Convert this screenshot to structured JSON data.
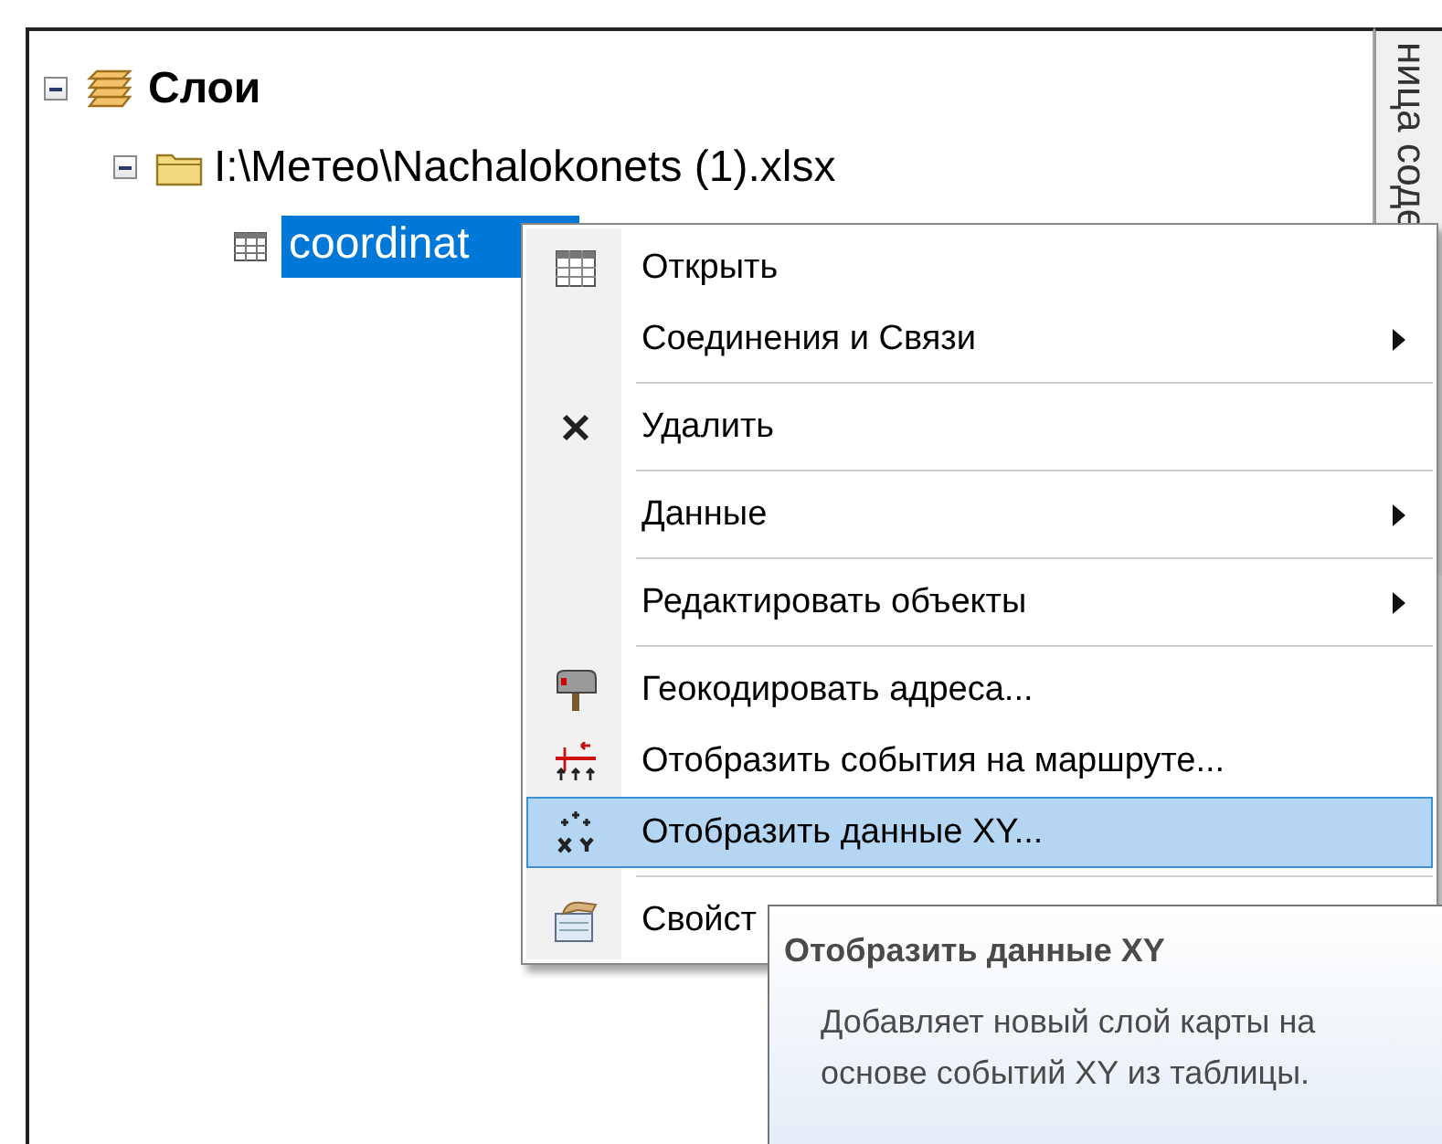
{
  "tree": {
    "label": "Слои",
    "expanded": true,
    "children": [
      {
        "label": "I:\\Meтео\\Nachalokonets (1).xlsx",
        "expanded": true,
        "children": [
          {
            "label": "coordinat",
            "selected": true
          }
        ]
      }
    ]
  },
  "side_tab": {
    "label": "ница соде"
  },
  "context_menu": {
    "items": [
      {
        "label": "Открыть",
        "submenu": false,
        "selected": false,
        "separator_after": false
      },
      {
        "label": "Соединения и Связи",
        "submenu": true,
        "selected": false,
        "separator_after": true
      },
      {
        "label": "Удалить",
        "submenu": false,
        "selected": false,
        "separator_after": true
      },
      {
        "label": "Данные",
        "submenu": true,
        "selected": false,
        "separator_after": true
      },
      {
        "label": "Редактировать объекты",
        "submenu": true,
        "selected": false,
        "separator_after": true
      },
      {
        "label": "Геокодировать адреса...",
        "submenu": false,
        "selected": false,
        "separator_after": false
      },
      {
        "label": "Отобразить события на маршруте...",
        "submenu": false,
        "selected": false,
        "separator_after": false
      },
      {
        "label": "Отобразить данные XY...",
        "submenu": false,
        "selected": true,
        "separator_after": true
      },
      {
        "label": "Свойст",
        "submenu": false,
        "selected": false,
        "separator_after": false
      }
    ]
  },
  "tooltip": {
    "title": "Отобразить данные XY",
    "text": "Добавляет новый слой карты на основе событий XY из таблицы."
  }
}
